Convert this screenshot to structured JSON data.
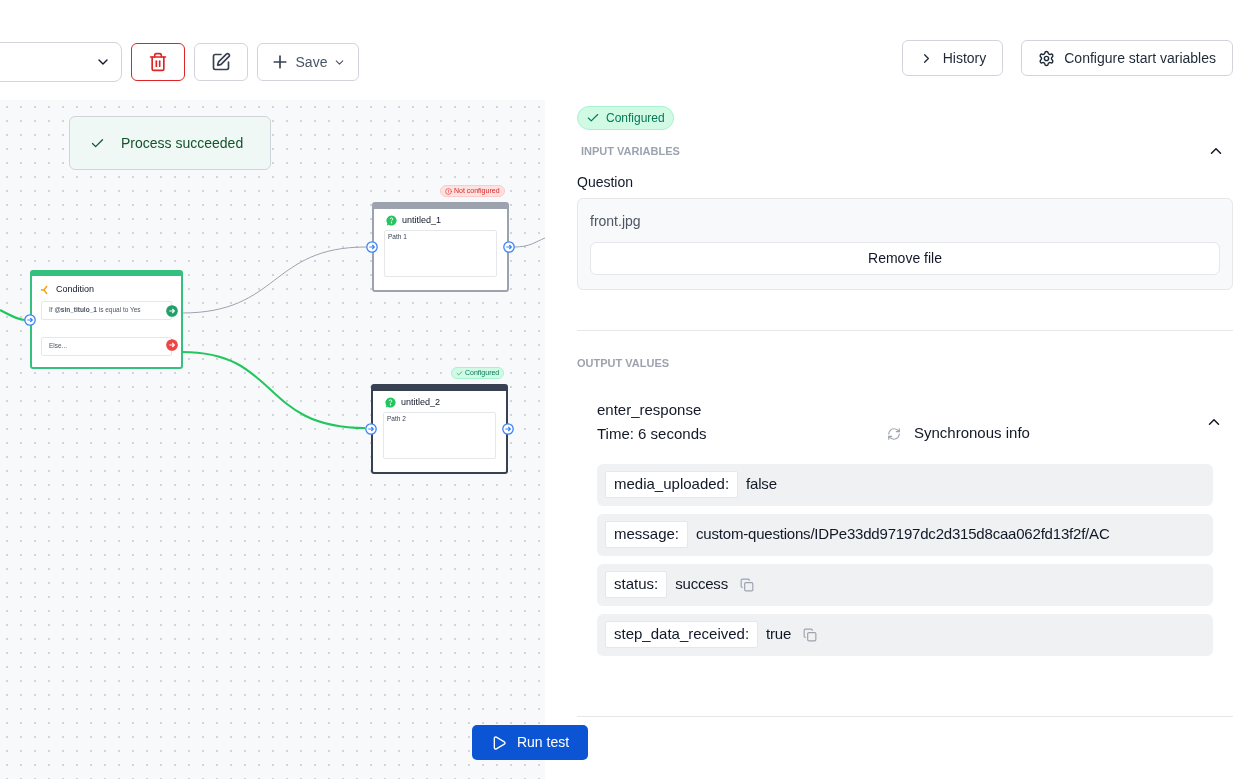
{
  "toolbar": {
    "save_label": "Save"
  },
  "header_buttons": [
    {
      "kind": "history",
      "label": "History"
    },
    {
      "kind": "configure",
      "label": "Configure start variables"
    }
  ],
  "toast": {
    "text": "Process succeeded"
  },
  "condition_node": {
    "title": "Condition",
    "rules": [
      {
        "kind": "if",
        "text": "If **@sin_titulo_1** is equal to Yes"
      },
      {
        "kind": "else",
        "text": "Else..."
      }
    ]
  },
  "question_nodes": [
    {
      "title": "untitled_1",
      "path": "Path 1",
      "status": {
        "kind": "not_configured",
        "label": "Not configured"
      }
    },
    {
      "title": "untitled_2",
      "path": "Path 2",
      "status": {
        "kind": "configured",
        "label": "Configured"
      }
    }
  ],
  "panel": {
    "status": {
      "kind": "configured",
      "label": "Configured"
    },
    "input_section": {
      "title": "INPUT VARIABLES",
      "expanded": true,
      "field_label": "Question",
      "file_name": "front.jpg",
      "remove_label": "Remove file"
    },
    "output_section": {
      "title": "OUTPUT VALUES",
      "step": {
        "name": "enter_response",
        "time": "Time: 6 seconds",
        "mode": "Synchronous info",
        "expanded": true
      },
      "values": [
        {
          "key": "media_uploaded:",
          "value": "false",
          "copyable": false
        },
        {
          "key": "message:",
          "value": "custom-questions/IDPe33dd97197dc2d315d8caa062fd13f2f/AC",
          "copyable": false
        },
        {
          "key": "status:",
          "value": "success",
          "copyable": true
        },
        {
          "key": "step_data_received:",
          "value": "true",
          "copyable": true
        }
      ]
    }
  },
  "run_button": {
    "label": "Run test"
  }
}
